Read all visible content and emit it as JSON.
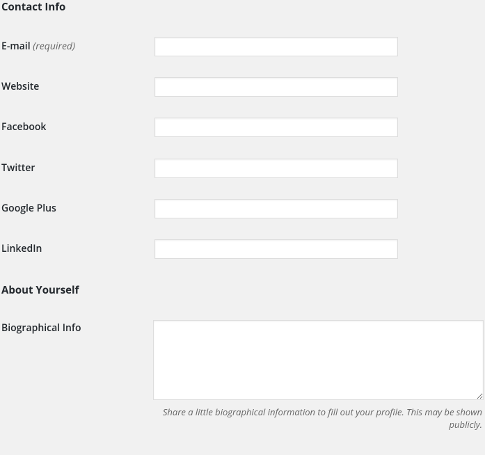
{
  "sections": {
    "contact": {
      "heading": "Contact Info",
      "fields": {
        "email": {
          "label": "E-mail",
          "required_note": "(required)",
          "value": ""
        },
        "website": {
          "label": "Website",
          "value": ""
        },
        "facebook": {
          "label": "Facebook",
          "value": ""
        },
        "twitter": {
          "label": "Twitter",
          "value": ""
        },
        "googleplus": {
          "label": "Google Plus",
          "value": ""
        },
        "linkedin": {
          "label": "LinkedIn",
          "value": ""
        }
      }
    },
    "about": {
      "heading": "About Yourself",
      "fields": {
        "bio": {
          "label": "Biographical Info",
          "value": "",
          "description": "Share a little biographical information to fill out your profile. This may be shown publicly."
        }
      }
    }
  }
}
